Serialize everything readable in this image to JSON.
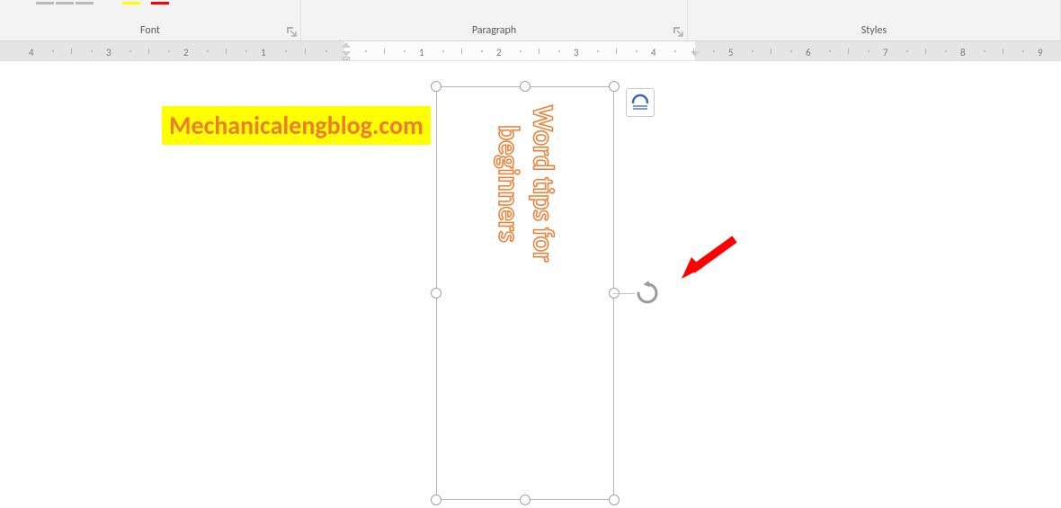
{
  "ribbon": {
    "groups": {
      "font": "Font",
      "paragraph": "Paragraph",
      "styles": "Styles"
    }
  },
  "ruler": {
    "left_marks": [
      "4",
      "3",
      "2",
      "1"
    ],
    "right_marks": [
      "1",
      "2",
      "3",
      "4",
      "5",
      "6",
      "7",
      "8",
      "9"
    ]
  },
  "watermark": {
    "text": "Mechanicalengblog.com"
  },
  "textbox": {
    "line1": "Word tips for",
    "line2": "beginners"
  },
  "icons": {
    "layout_options": "layout-options-icon",
    "rotate": "rotate-icon"
  }
}
